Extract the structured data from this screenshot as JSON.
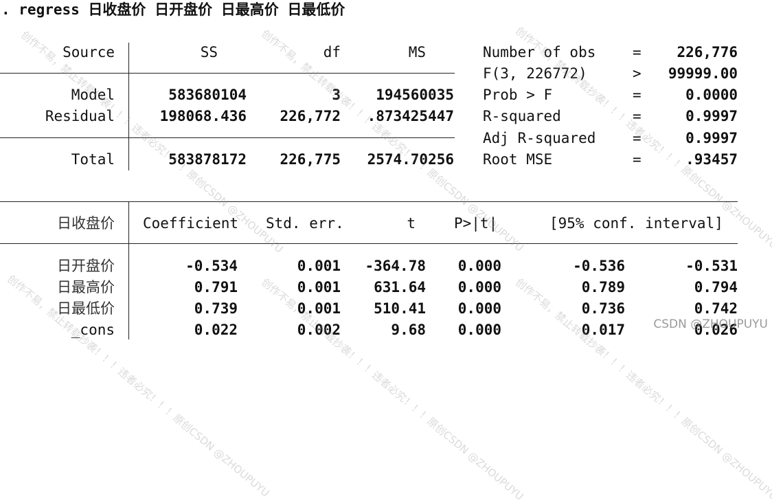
{
  "command": ". regress 日收盘价 日开盘价 日最高价 日最低价",
  "anova": {
    "headers": [
      "Source",
      "SS",
      "df",
      "MS"
    ],
    "rows": [
      {
        "source": "Model",
        "ss": "583680104",
        "df": "3",
        "ms": "194560035"
      },
      {
        "source": "Residual",
        "ss": "198068.436",
        "df": "226,772",
        "ms": ".873425447"
      },
      {
        "source": "Total",
        "ss": "583878172",
        "df": "226,775",
        "ms": "2574.70256"
      }
    ]
  },
  "stats": [
    {
      "label": "Number of obs",
      "op": "=",
      "value": "226,776"
    },
    {
      "label": "F(3, 226772)",
      "op": ">",
      "value": "99999.00"
    },
    {
      "label": "Prob > F",
      "op": "=",
      "value": "0.0000"
    },
    {
      "label": "R-squared",
      "op": "=",
      "value": "0.9997"
    },
    {
      "label": "Adj R-squared",
      "op": "=",
      "value": "0.9997"
    },
    {
      "label": "Root MSE",
      "op": "=",
      "value": ".93457"
    }
  ],
  "coef": {
    "depvar": "日收盘价",
    "headers": [
      "Coefficient",
      "Std. err.",
      "t",
      "P>|t|",
      "[95% conf. interval]"
    ],
    "rows": [
      {
        "var": "日开盘价",
        "coef": "-0.534",
        "se": "0.001",
        "t": "-364.78",
        "p": "0.000",
        "lo": "-0.536",
        "hi": "-0.531"
      },
      {
        "var": "日最高价",
        "coef": "0.791",
        "se": "0.001",
        "t": "631.64",
        "p": "0.000",
        "lo": "0.789",
        "hi": "0.794"
      },
      {
        "var": "日最低价",
        "coef": "0.739",
        "se": "0.001",
        "t": "510.41",
        "p": "0.000",
        "lo": "0.736",
        "hi": "0.742"
      },
      {
        "var": "_cons",
        "coef": "0.022",
        "se": "0.002",
        "t": "9.68",
        "p": "0.000",
        "lo": "0.017",
        "hi": "0.026"
      }
    ]
  },
  "watermark": {
    "text": "创作不易，禁止转载抄袭！！！违者必究！！！原创CSDN @ZHOUPUYU",
    "brand": "CSDN @ZHOUPUYU"
  }
}
